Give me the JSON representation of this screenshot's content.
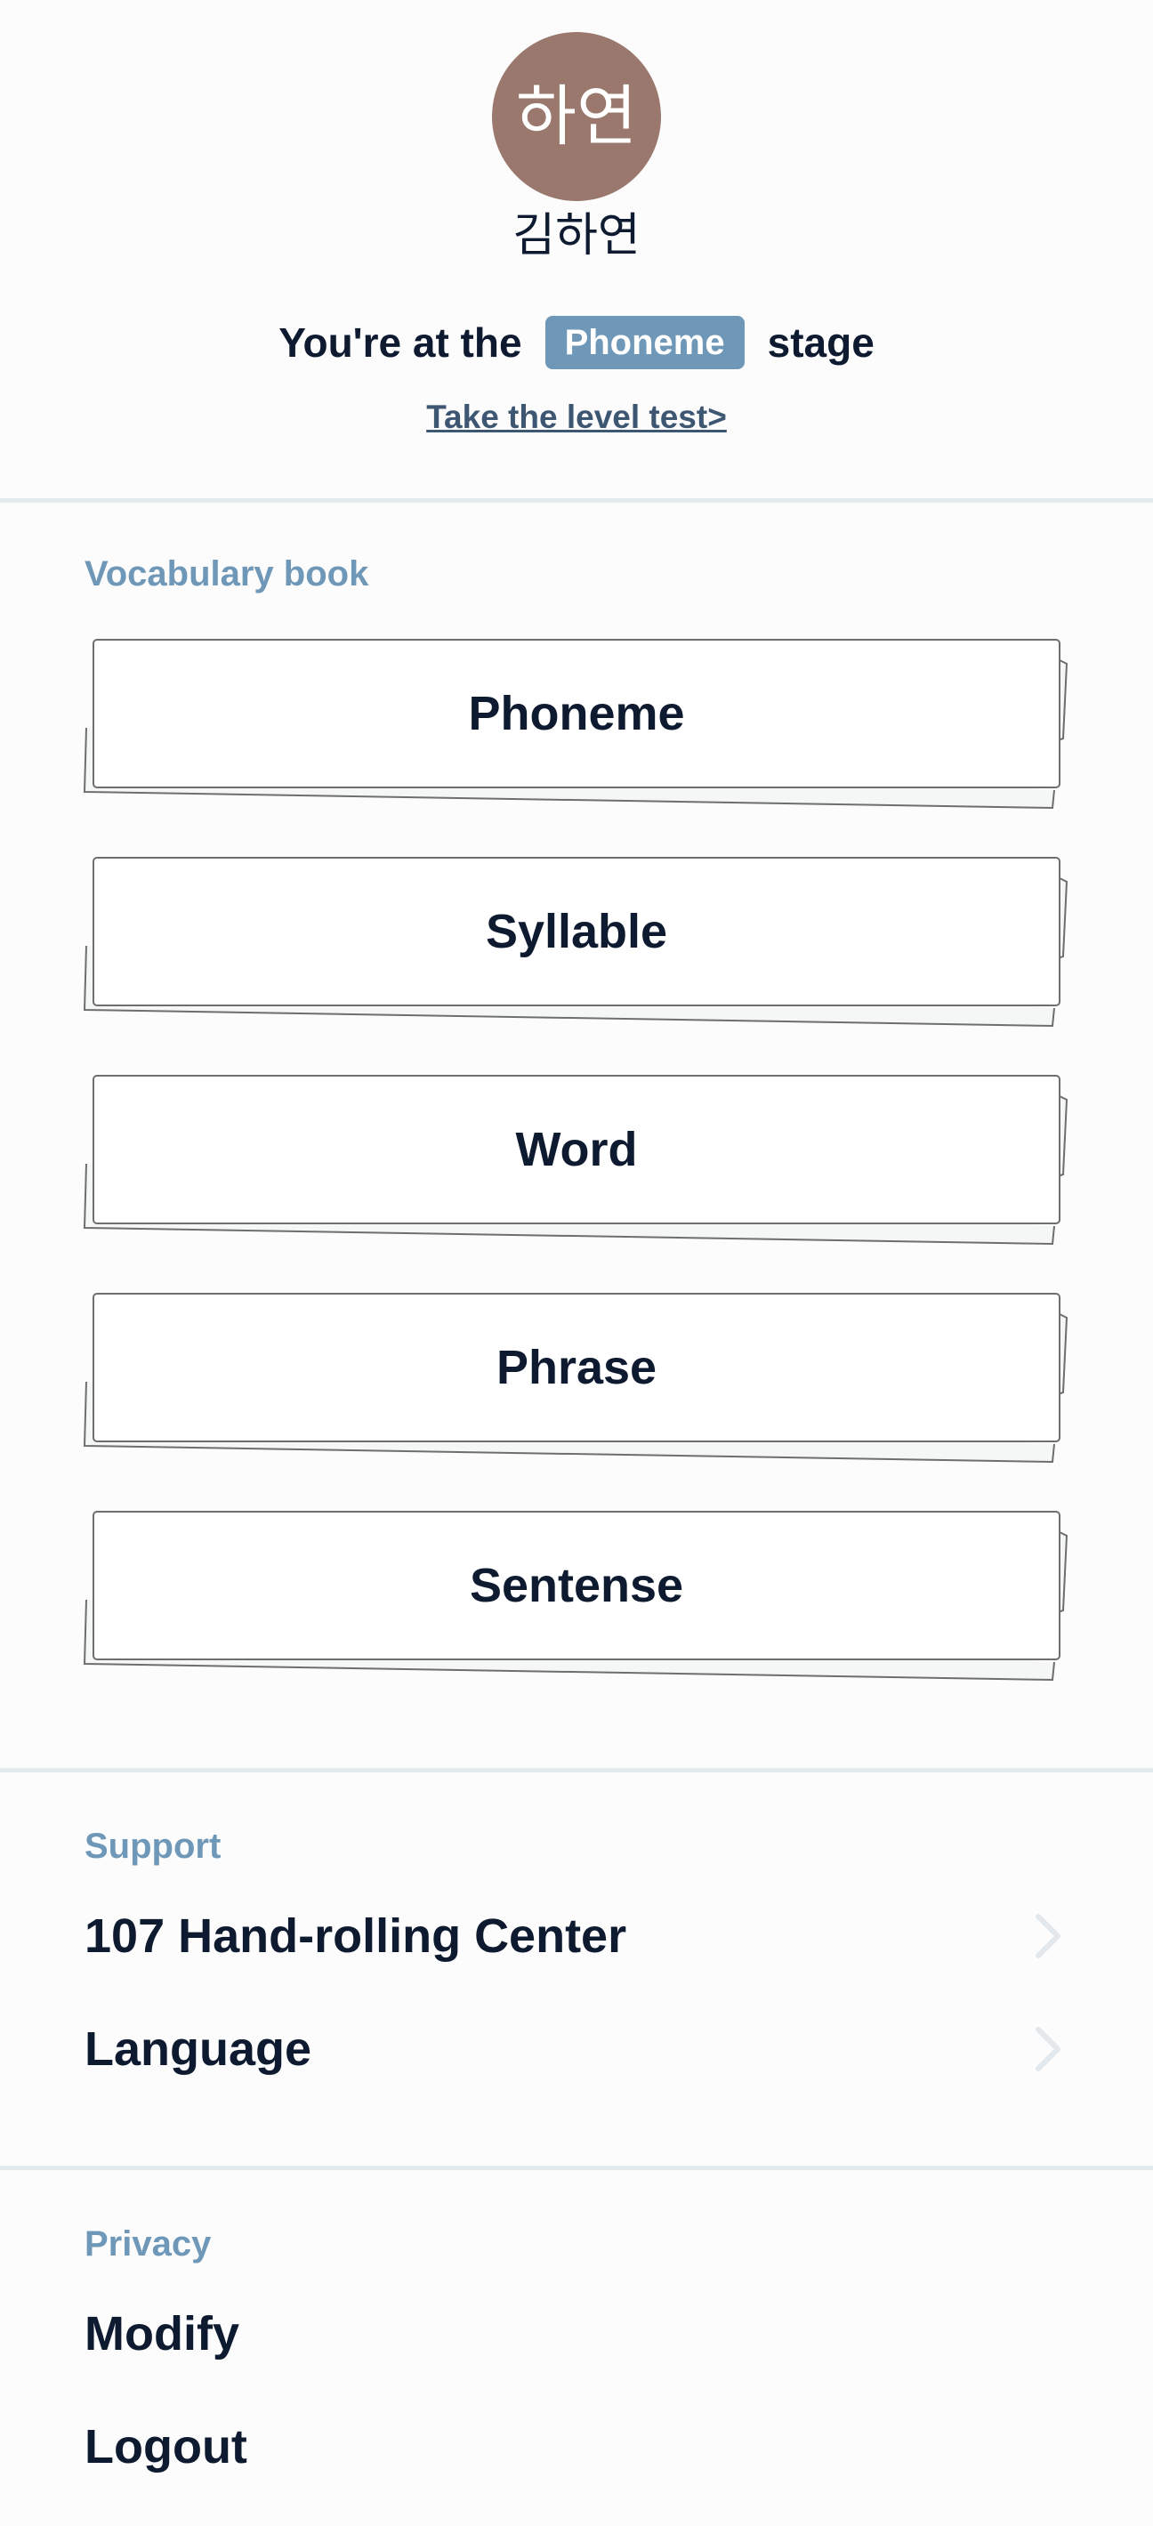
{
  "profile": {
    "avatar_initials": "하연",
    "name": "김하연",
    "stage_prefix": "You're at the",
    "stage_name": "Phoneme",
    "stage_suffix": "stage",
    "level_test_link": "Take the level test>"
  },
  "vocabulary": {
    "title": "Vocabulary book",
    "items": [
      {
        "label": "Phoneme"
      },
      {
        "label": "Syllable"
      },
      {
        "label": "Word"
      },
      {
        "label": "Phrase"
      },
      {
        "label": "Sentense"
      }
    ]
  },
  "support": {
    "title": "Support",
    "items": [
      {
        "label": "107 Hand-rolling Center",
        "icon": "chevron-right-icon"
      },
      {
        "label": "Language",
        "icon": "chevron-right-icon"
      }
    ]
  },
  "privacy": {
    "title": "Privacy",
    "items": [
      {
        "label": "Modify"
      },
      {
        "label": "Logout"
      }
    ]
  },
  "colors": {
    "accent": "#6f98b8",
    "avatar": "#9a786d",
    "text": "#0e1a30",
    "divider": "#e4ebef"
  }
}
